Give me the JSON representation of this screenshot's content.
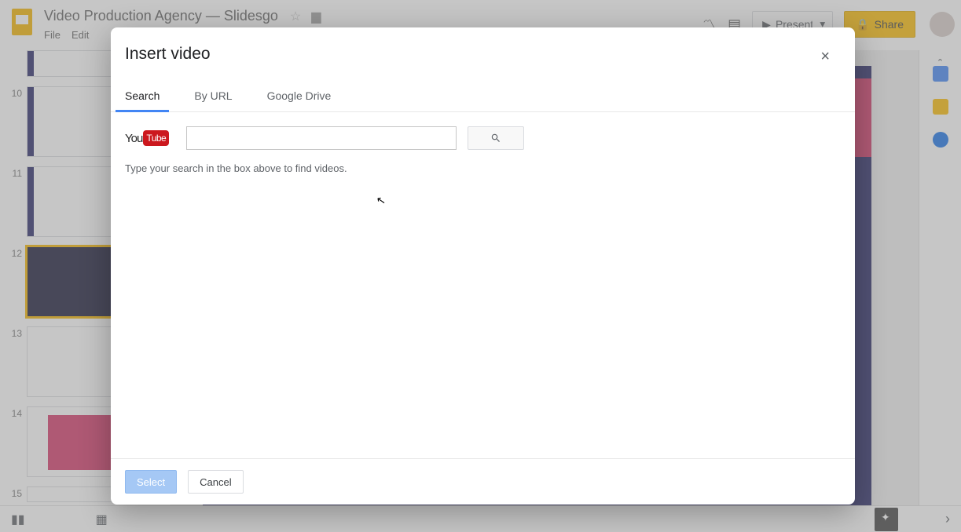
{
  "app": {
    "doc_title": "Video Production Agency — Slidesgo",
    "menus": [
      "File",
      "Edit"
    ],
    "present_label": "Present",
    "share_label": "Share"
  },
  "filmstrip": {
    "slides": [
      {
        "num": "10",
        "selected": false
      },
      {
        "num": "11",
        "selected": false
      },
      {
        "num": "12",
        "selected": true
      },
      {
        "num": "13",
        "selected": false
      },
      {
        "num": "14",
        "selected": false
      },
      {
        "num": "15",
        "selected": false
      }
    ]
  },
  "modal": {
    "title": "Insert video",
    "tabs": {
      "search": "Search",
      "by_url": "By URL",
      "drive": "Google Drive"
    },
    "youtube": {
      "you": "You",
      "tube": "Tube"
    },
    "search_value": "",
    "hint": "Type your search in the box above to find videos.",
    "select_label": "Select",
    "cancel_label": "Cancel",
    "close_glyph": "×"
  }
}
